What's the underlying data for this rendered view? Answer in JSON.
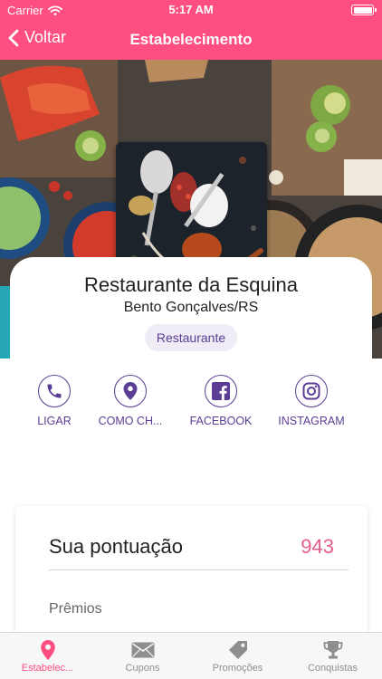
{
  "status": {
    "carrier": "Carrier",
    "time": "5:17 AM"
  },
  "nav": {
    "back_label": "Voltar",
    "title": "Estabelecimento"
  },
  "establishment": {
    "name": "Restaurante da Esquina",
    "city": "Bento Gonçalves/RS",
    "category": "Restaurante"
  },
  "actions": [
    {
      "label": "LIGAR",
      "icon": "phone-icon"
    },
    {
      "label": "COMO CH...",
      "icon": "map-pin-icon"
    },
    {
      "label": "FACEBOOK",
      "icon": "facebook-icon"
    },
    {
      "label": "INSTAGRAM",
      "icon": "instagram-icon"
    }
  ],
  "score": {
    "label": "Sua pontuação",
    "value": "943",
    "prizes_label": "Prêmios"
  },
  "tabs": [
    {
      "label": "Estabelec...",
      "icon": "map-pin-icon",
      "active": true
    },
    {
      "label": "Cupons",
      "icon": "envelope-icon",
      "active": false
    },
    {
      "label": "Promoções",
      "icon": "tag-icon",
      "active": false
    },
    {
      "label": "Conquistas",
      "icon": "trophy-icon",
      "active": false
    }
  ],
  "colors": {
    "accent": "#ff4f80",
    "purple": "#5b3d95",
    "score": "#e85d8d",
    "tab_inactive": "#8e8e8e"
  }
}
